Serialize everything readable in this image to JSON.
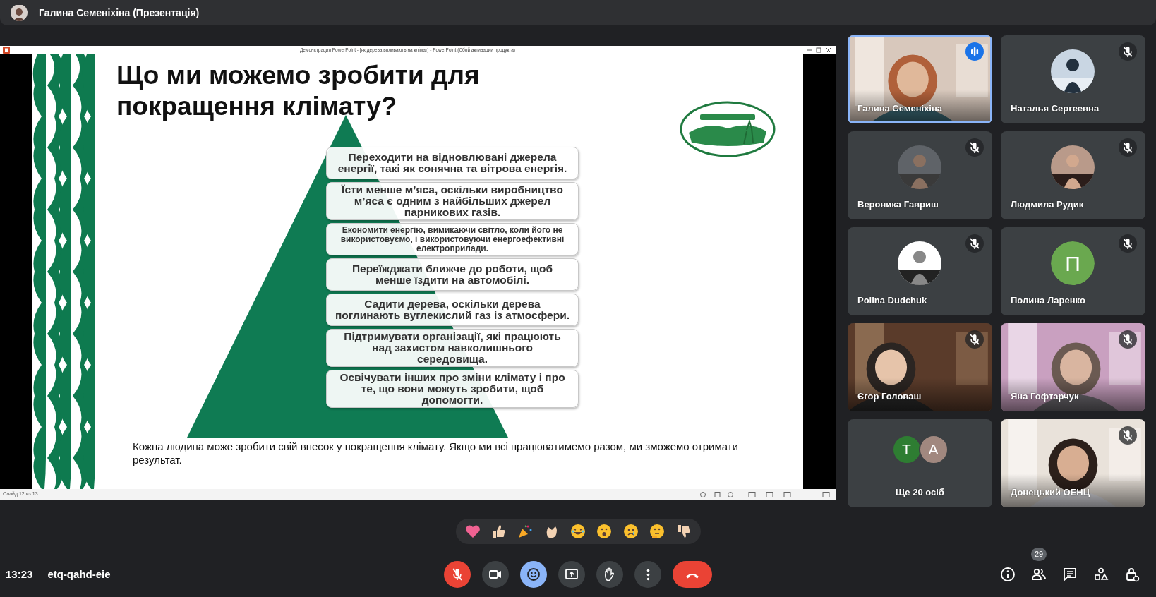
{
  "header": {
    "presenter_title": "Галина Семеніхіна (Презентація)"
  },
  "presentation": {
    "window_title": "Демонстрация PowerPoint - [як дерева впливають на клімат] - PowerPoint (Сбой активации продукта)",
    "slide": {
      "title": "Що ми можемо зробити для покращення клімату?",
      "steps": [
        {
          "text": "Переходити на відновлювані джерела енергії, такі як сонячна та вітрова енергія.",
          "kind": "normal"
        },
        {
          "text": "Їсти менше м’яса, оскільки виробництво м’яса є одним з найбільших джерел парникових газів.",
          "kind": "normal"
        },
        {
          "text": "Економити енергію, вимикаючи світло, коли його не використовуємо, і використовуючи енергоефективні електроприлади.",
          "kind": "compact"
        },
        {
          "text": "Переїжджати ближче до роботи, щоб менше їздити на автомобілі.",
          "kind": "normal"
        },
        {
          "text": "Садити дерева, оскільки дерева поглинають вуглекислий газ із атмосфери.",
          "kind": "normal"
        },
        {
          "text": "Підтримувати організації, які працюють над захистом навколишнього середовища.",
          "kind": "normal"
        },
        {
          "text": "Освічувати інших про зміни клімату і про те, що вони можуть зробити, щоб допомогти.",
          "kind": "normal"
        }
      ],
      "footer": "Кожна людина може зробити свій внесок у покращення клімату. Якщо ми всі працюватимемо разом, ми зможемо отримати результат."
    },
    "status": "Слайд 12 из 13"
  },
  "tiles": [
    {
      "name": "Галина Семеніхіна",
      "kind": "video",
      "muted": false,
      "speaking": true
    },
    {
      "name": "Наталья Сергеевна",
      "muted": true,
      "speaking": false
    },
    {
      "name": "Вероника Гавриш",
      "muted": true,
      "speaking": false
    },
    {
      "name": "Людмила Рудик",
      "muted": true,
      "speaking": false
    },
    {
      "name": "Polina Dudchuk",
      "muted": true,
      "speaking": false
    },
    {
      "name": "Полина Ларенко",
      "kind": "initial",
      "initial": "П",
      "color": "#6aa84f",
      "muted": true,
      "speaking": false
    },
    {
      "name": "Єгор Головаш",
      "kind": "video",
      "muted": true,
      "speaking": false
    },
    {
      "name": "Яна Гофтарчук",
      "kind": "video",
      "muted": true,
      "speaking": false
    },
    {
      "name": "Ще 20 осіб",
      "kind": "group",
      "avatars": [
        {
          "initial": "Т",
          "color": "#2e7d32"
        },
        {
          "initial": "А",
          "color": "#a1887f"
        }
      ],
      "muted": false,
      "speaking": false
    },
    {
      "name": "Донецький ОЕНЦ",
      "kind": "video",
      "muted": true,
      "speaking": false
    }
  ],
  "meeting": {
    "time": "13:23",
    "code": "etq-qahd-eie"
  },
  "reactions": [
    {
      "kind": "heart"
    },
    {
      "kind": "thumbs-up"
    },
    {
      "kind": "party"
    },
    {
      "kind": "clap"
    },
    {
      "kind": "laugh"
    },
    {
      "kind": "surprised"
    },
    {
      "kind": "sad"
    },
    {
      "kind": "thinking"
    },
    {
      "kind": "thumbs-down"
    }
  ],
  "controls": [
    {
      "kind": "mic",
      "on": false
    },
    {
      "kind": "camera",
      "on": true
    },
    {
      "kind": "reactions",
      "on": true
    },
    {
      "kind": "present"
    },
    {
      "kind": "hand"
    },
    {
      "kind": "more"
    },
    {
      "kind": "leave"
    }
  ],
  "side_buttons": [
    {
      "kind": "info"
    },
    {
      "kind": "people",
      "badge": "29"
    },
    {
      "kind": "chat"
    },
    {
      "kind": "activities"
    },
    {
      "kind": "host"
    }
  ]
}
